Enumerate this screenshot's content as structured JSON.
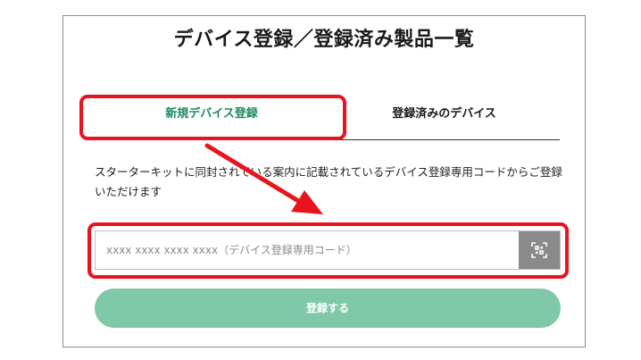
{
  "page": {
    "title": "デバイス登録／登録済み製品一覧"
  },
  "tabs": [
    {
      "label": "新規デバイス登録",
      "active": true
    },
    {
      "label": "登録済みのデバイス",
      "active": false
    }
  ],
  "description": "スターターキットに同封されている案内に記載されているデバイス登録専用コードからご登録いただけます",
  "code_input": {
    "value": "",
    "placeholder": "xxxx xxxx xxxx xxxx（デバイス登録専用コード）"
  },
  "scan_button": {
    "icon": "qr-scan-icon"
  },
  "submit_button": {
    "label": "登録する"
  },
  "colors": {
    "accent_green": "#1f8a5f",
    "submit_disabled": "#7fc9a9",
    "annotation_red": "#e8141d",
    "scan_button_gray": "#8a8a8a"
  }
}
